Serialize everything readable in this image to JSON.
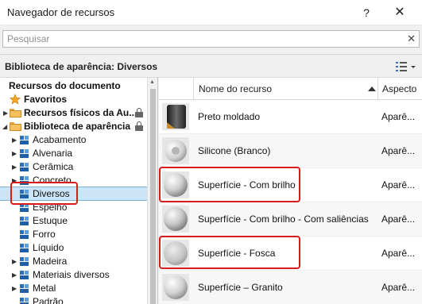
{
  "window": {
    "title": "Navegador de recursos",
    "help_label": "?",
    "close_label": "✕"
  },
  "search": {
    "placeholder": "Pesquisar",
    "clear_label": "✕"
  },
  "library_header": {
    "title": "Biblioteca de aparência: Diversos",
    "view_button_icon": "list-view-icon"
  },
  "tree": {
    "section_title": "Recursos do documento",
    "items": [
      {
        "label": "Favoritos",
        "icon": "star-icon"
      },
      {
        "label": "Recursos físicos da Au...",
        "icon": "folder-icon",
        "locked": true
      },
      {
        "label": "Biblioteca de aparência",
        "icon": "folder-icon",
        "locked": true
      },
      {
        "label": "Acabamento"
      },
      {
        "label": "Alvenaria"
      },
      {
        "label": "Cerâmica"
      },
      {
        "label": "Concreto"
      },
      {
        "label": "Diversos",
        "selected": true
      },
      {
        "label": "Espelho"
      },
      {
        "label": "Estuque"
      },
      {
        "label": "Forro"
      },
      {
        "label": "Líquido"
      },
      {
        "label": "Madeira"
      },
      {
        "label": "Materiais diversos"
      },
      {
        "label": "Metal"
      },
      {
        "label": "Padrão"
      }
    ]
  },
  "grid": {
    "columns": {
      "name": "Nome do recurso",
      "aspect": "Aspecto"
    },
    "rows": [
      {
        "name": "Preto moldado",
        "aspect": "Aparê..."
      },
      {
        "name": "Silicone (Branco)",
        "aspect": "Aparê..."
      },
      {
        "name": "Superfície - Com brilho",
        "aspect": "Aparê..."
      },
      {
        "name": "Superfície - Com brilho - Com saliências",
        "aspect": "Aparê..."
      },
      {
        "name": "Superfície - Fosca",
        "aspect": "Aparê..."
      },
      {
        "name": "Superfície – Granito",
        "aspect": "Aparê..."
      }
    ]
  },
  "colors": {
    "highlight": "#d81b1b",
    "selection": "#cce4f7"
  }
}
